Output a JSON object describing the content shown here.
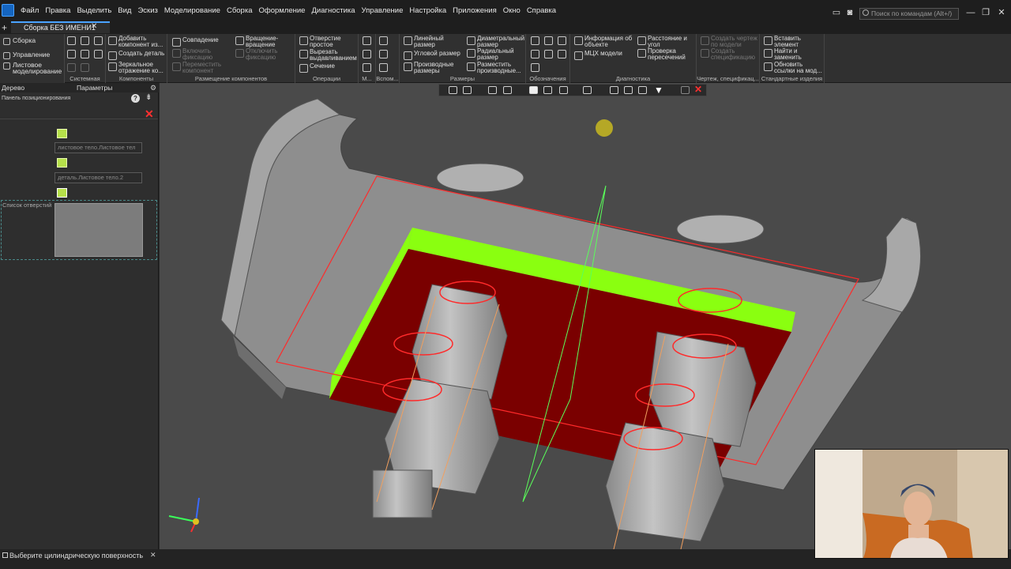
{
  "menu": [
    "Файл",
    "Правка",
    "Выделить",
    "Вид",
    "Эскиз",
    "Моделирование",
    "Сборка",
    "Оформление",
    "Диагностика",
    "Управление",
    "Настройка",
    "Приложения",
    "Окно",
    "Справка"
  ],
  "search_placeholder": "Поиск по командам (Alt+/)",
  "doc_tab": "Сборка БЕЗ ИМЕНИ1",
  "modes": [
    "Сборка",
    "Управление",
    "Листовое",
    "моделирование"
  ],
  "ribbon": {
    "components": {
      "add_component": [
        "Добавить",
        "компонент из..."
      ],
      "create_part": "Создать деталь",
      "mirror": [
        "Зеркальное",
        "отражение ко..."
      ]
    },
    "placement": {
      "coincide": "Совпадение",
      "rotate": [
        "Вращение-",
        "вращение"
      ],
      "enable_fix": [
        "Включить",
        "фиксацию"
      ],
      "disable_fix": [
        "Отключить",
        "фиксацию"
      ],
      "move": [
        "Переместить",
        "компонент"
      ]
    },
    "operations": {
      "hole_simple": [
        "Отверстие",
        "простое"
      ],
      "cut_extrude": [
        "Вырезать",
        "выдавливанием"
      ],
      "section": "Сечение"
    },
    "dimensions": {
      "linear": [
        "Линейный",
        "размер"
      ],
      "diametral": [
        "Диаметральный",
        "размер"
      ],
      "angular": "Угловой размер",
      "radial": [
        "Радиальный",
        "размер"
      ],
      "derived": [
        "Производные",
        "размеры"
      ],
      "place_derived": [
        "Разместить",
        "производные..."
      ]
    },
    "diagnostics": {
      "info": [
        "Информация об",
        "объекте"
      ],
      "distance": [
        "Расстояние и",
        "угол"
      ],
      "mass": "МЦХ модели",
      "intersect": [
        "Проверка",
        "пересечений"
      ]
    },
    "drawing": {
      "create_drawing": [
        "Создать чертеж",
        "по модели"
      ],
      "create_spec": [
        "Создать",
        "спецификацию"
      ]
    },
    "standard": {
      "insert": [
        "Вставить",
        "элемент"
      ],
      "find_replace": [
        "Найти и",
        "заменить"
      ],
      "update_links": [
        "Обновить",
        "ссылки на мод..."
      ]
    },
    "group_labels": [
      "Системная",
      "Компоненты",
      "Размещение компонентов",
      "Операции",
      "М...",
      "Вспом...",
      "Размеры",
      "Обозначения",
      "Диагностика",
      "Чертеж, спецификац...",
      "Стандартные изделия"
    ]
  },
  "panel": {
    "tab_tree": "Дерево",
    "tab_params": "Параметры",
    "subtitle": "Панель позиционирования",
    "field1": "листовое тело.Листовое тел",
    "field2": "деталь.Листовое тело.2",
    "holes_label": "Список отверстий"
  },
  "status": "Выберите цилиндрическую поверхность",
  "colors": {
    "accent": "#4aa3ff",
    "face_green": "#8aff10",
    "face_red": "#7a0000",
    "edge_red": "#ff2a2a"
  }
}
